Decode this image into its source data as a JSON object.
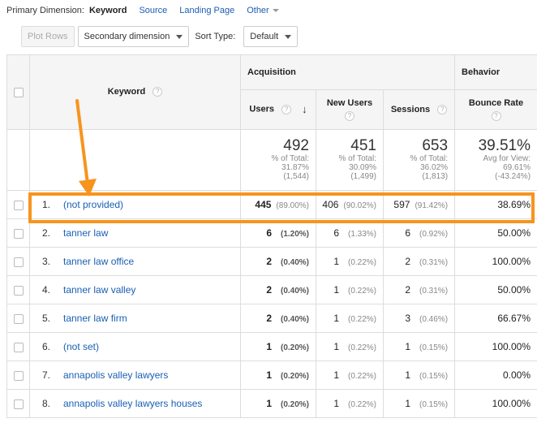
{
  "top_bar": {
    "label": "Primary Dimension:",
    "active": "Keyword",
    "links": [
      "Source",
      "Landing Page"
    ],
    "other": "Other"
  },
  "toolbar": {
    "plot_rows": "Plot Rows",
    "secondary_dimension": "Secondary dimension",
    "sort_type_label": "Sort Type:",
    "sort_type_value": "Default"
  },
  "table": {
    "keyword_header": "Keyword",
    "groups": [
      "Acquisition",
      "Behavior"
    ],
    "columns": [
      "Users",
      "New Users",
      "Sessions",
      "Bounce Rate"
    ],
    "help_icon": "?",
    "sort_indicator": "↓",
    "totals": [
      {
        "value": "492",
        "lines": [
          "% of Total:",
          "31.87%",
          "(1,544)"
        ]
      },
      {
        "value": "451",
        "lines": [
          "% of Total:",
          "30.09%",
          "(1,499)"
        ]
      },
      {
        "value": "653",
        "lines": [
          "% of Total:",
          "36.02%",
          "(1,813)"
        ]
      },
      {
        "value": "39.51%",
        "lines": [
          "Avg for View:",
          "69.61%",
          "(-43.24%)"
        ]
      }
    ],
    "rows": [
      {
        "num": "1.",
        "keyword": "(not provided)",
        "users": "445",
        "users_pct": "(89.00%)",
        "new_users": "406",
        "new_users_pct": "(90.02%)",
        "sessions": "597",
        "sessions_pct": "(91.42%)",
        "bounce": "38.69%"
      },
      {
        "num": "2.",
        "keyword": "tanner law",
        "users": "6",
        "users_pct": "(1.20%)",
        "new_users": "6",
        "new_users_pct": "(1.33%)",
        "sessions": "6",
        "sessions_pct": "(0.92%)",
        "bounce": "50.00%"
      },
      {
        "num": "3.",
        "keyword": "tanner law office",
        "users": "2",
        "users_pct": "(0.40%)",
        "new_users": "1",
        "new_users_pct": "(0.22%)",
        "sessions": "2",
        "sessions_pct": "(0.31%)",
        "bounce": "100.00%"
      },
      {
        "num": "4.",
        "keyword": "tanner law valley",
        "users": "2",
        "users_pct": "(0.40%)",
        "new_users": "1",
        "new_users_pct": "(0.22%)",
        "sessions": "2",
        "sessions_pct": "(0.31%)",
        "bounce": "50.00%"
      },
      {
        "num": "5.",
        "keyword": "tanner law firm",
        "users": "2",
        "users_pct": "(0.40%)",
        "new_users": "1",
        "new_users_pct": "(0.22%)",
        "sessions": "3",
        "sessions_pct": "(0.46%)",
        "bounce": "66.67%"
      },
      {
        "num": "6.",
        "keyword": "(not set)",
        "users": "1",
        "users_pct": "(0.20%)",
        "new_users": "1",
        "new_users_pct": "(0.22%)",
        "sessions": "1",
        "sessions_pct": "(0.15%)",
        "bounce": "100.00%"
      },
      {
        "num": "7.",
        "keyword": "annapolis valley lawyers",
        "users": "1",
        "users_pct": "(0.20%)",
        "new_users": "1",
        "new_users_pct": "(0.22%)",
        "sessions": "1",
        "sessions_pct": "(0.15%)",
        "bounce": "0.00%"
      },
      {
        "num": "8.",
        "keyword": "annapolis valley lawyers houses",
        "users": "1",
        "users_pct": "(0.20%)",
        "new_users": "1",
        "new_users_pct": "(0.22%)",
        "sessions": "1",
        "sessions_pct": "(0.15%)",
        "bounce": "100.00%"
      }
    ]
  },
  "annotation": {
    "color": "#f7941d"
  },
  "colors": {
    "link": "#1a5fb4",
    "header_bg": "#f5f5f5",
    "border": "#dddddd"
  }
}
